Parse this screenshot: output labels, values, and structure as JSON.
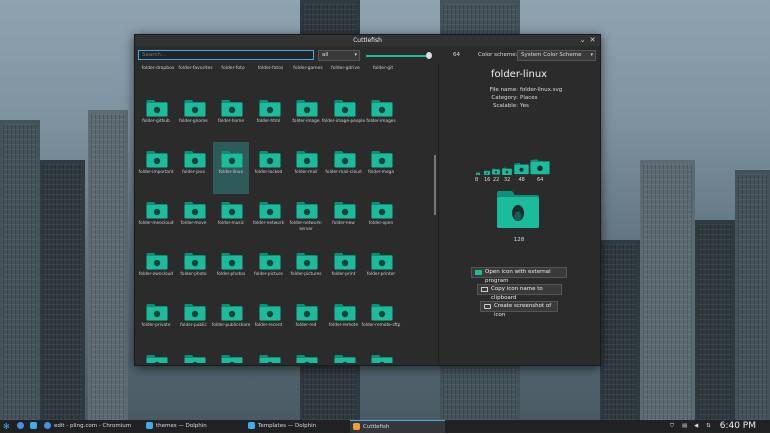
{
  "window": {
    "title": "Cuttlefish",
    "minimize_glyph": "⌄",
    "close_glyph": "✕"
  },
  "toolbar": {
    "search_placeholder": "Search...",
    "filter_value": "all",
    "size_value": 64,
    "size_fraction": 0.98,
    "color_scheme_label": "Color scheme:",
    "color_scheme_value": "System Color Scheme"
  },
  "icon_grid": {
    "top_row": [
      "folder-dropbox",
      "folder-favorites",
      "folder-foto",
      "folder-fotos",
      "folder-games",
      "folder-gdrive",
      "folder-git"
    ],
    "rows": [
      [
        "folder-github",
        "folder-gnome",
        "folder-home",
        "folder-html",
        "folder-image",
        "folder-image-people",
        "folder-images"
      ],
      [
        "folder-important",
        "folder-java",
        "folder-linux",
        "folder-locked",
        "folder-mail",
        "folder-mail-cloud",
        "folder-mega"
      ],
      [
        "folder-meocloud",
        "folder-move",
        "folder-music",
        "folder-network",
        "folder-network-server",
        "folder-new",
        "folder-open"
      ],
      [
        "folder-owncloud",
        "folder-photo",
        "folder-photos",
        "folder-picture",
        "folder-pictures",
        "folder-print",
        "folder-printer"
      ],
      [
        "folder-private",
        "folder-public",
        "folder-publicshare",
        "folder-recent",
        "folder-red",
        "folder-remote",
        "folder-remote-sftp"
      ]
    ],
    "selected": "folder-linux"
  },
  "details": {
    "name": "folder-linux",
    "file_name_label": "File name:",
    "file_name": "folder-linux.svg",
    "category_label": "Category:",
    "category": "Places",
    "scalable_label": "Scalable:",
    "scalable": "Yes",
    "sizes": [
      "8",
      "16",
      "22",
      "32",
      "48",
      "64"
    ],
    "big_size": "128",
    "actions": {
      "open_external": "Open icon with external program",
      "copy_name": "Copy icon name to clipboard",
      "screenshot": "Create screenshot of icon"
    }
  },
  "taskbar": {
    "items": [
      "edit - pling.com - Chromium",
      "themes — Dolphin",
      "Templates — Dolphin",
      "Cuttlefish"
    ],
    "clock": "6:40 PM"
  },
  "colors": {
    "accent": "#3daee9",
    "folder": "#1abc9c",
    "folder_dark": "#0e8f78"
  }
}
